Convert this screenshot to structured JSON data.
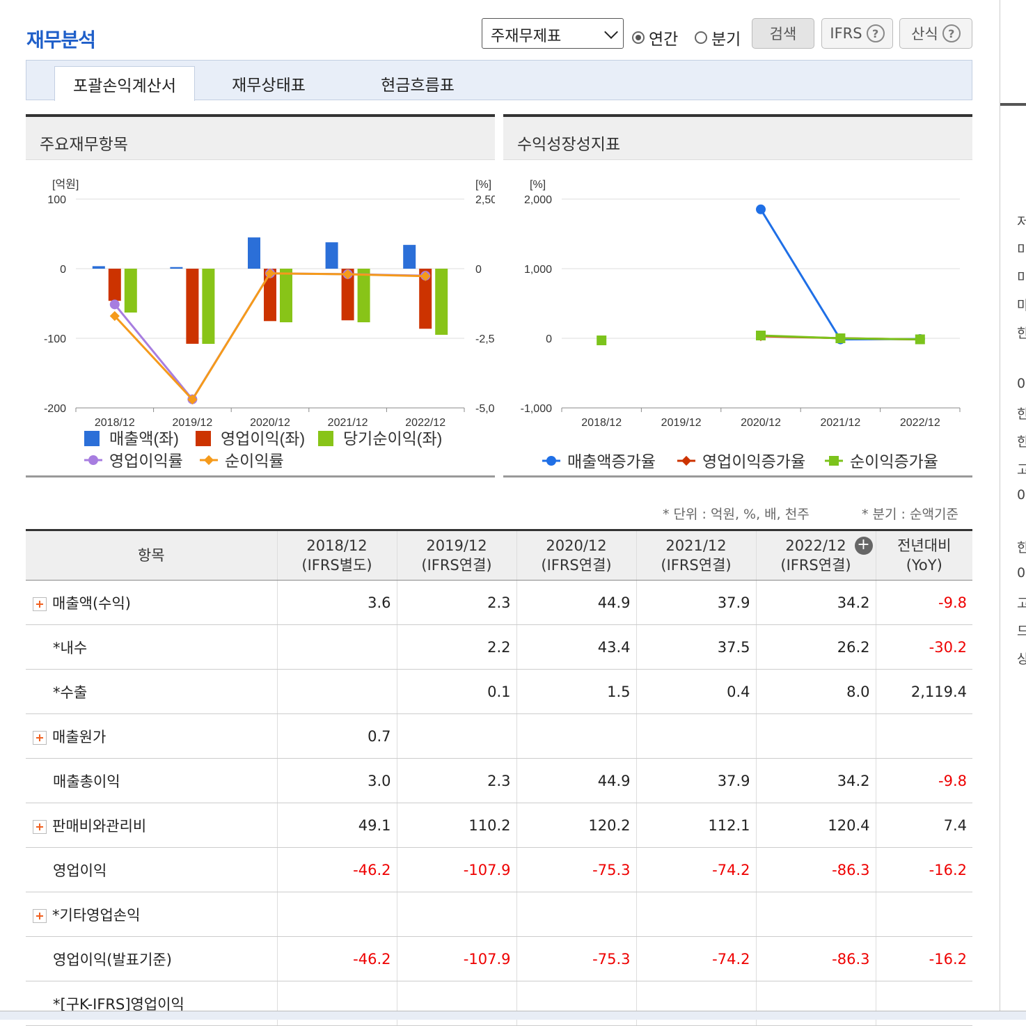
{
  "title": "재무분석",
  "controls": {
    "select_value": "주재무제표",
    "radio_annual": "연간",
    "radio_quarter": "분기",
    "search": "검색",
    "ifrs": "IFRS",
    "formula": "산식",
    "help_icon": "?"
  },
  "tabs": [
    "포괄손익계산서",
    "재무상태표",
    "현금흐름표"
  ],
  "left_panel": {
    "title": "주요재무항목"
  },
  "right_panel": {
    "title": "수익성장성지표"
  },
  "chart_data": [
    {
      "type": "bar",
      "categories": [
        "2018/12",
        "2019/12",
        "2020/12",
        "2021/12",
        "2022/12"
      ],
      "y_left": {
        "unit": "[억원]",
        "ticks": [
          "100",
          "0",
          "-100",
          "-200"
        ],
        "ylim": [
          -200,
          100
        ]
      },
      "y_right": {
        "unit": "[%]",
        "ticks": [
          "2,50",
          "0",
          "-2,5",
          "-5,0"
        ],
        "ylim": [
          -5000,
          2500
        ]
      },
      "series": [
        {
          "name": "매출액(좌)",
          "kind": "bar",
          "color": "#2b6fd8",
          "values": [
            3.6,
            2.3,
            44.9,
            37.9,
            34.2
          ]
        },
        {
          "name": "영업이익(좌)",
          "kind": "bar",
          "color": "#cc3300",
          "values": [
            -46.2,
            -107.9,
            -75.3,
            -74.2,
            -86.3
          ]
        },
        {
          "name": "당기순이익(좌)",
          "kind": "bar",
          "color": "#88c418",
          "values": [
            -63,
            -108,
            -77,
            -77,
            -95
          ]
        },
        {
          "name": "영업이익률",
          "kind": "line",
          "color": "#a77de0",
          "values": [
            -1283,
            -4691,
            -168,
            -196,
            -252
          ]
        },
        {
          "name": "순이익률",
          "kind": "line",
          "color": "#f59a1b",
          "values": [
            -1700,
            -4700,
            -170,
            -200,
            -270
          ]
        }
      ]
    },
    {
      "type": "line",
      "categories": [
        "2018/12",
        "2019/12",
        "2020/12",
        "2021/12",
        "2022/12"
      ],
      "y": {
        "unit": "[%]",
        "ticks": [
          "2,000",
          "1,000",
          "0",
          "-1,000"
        ],
        "ylim": [
          -1000,
          2000
        ]
      },
      "series": [
        {
          "name": "매출액증가율",
          "color": "#1f6fe6",
          "marker": "circle",
          "values": [
            null,
            null,
            1852,
            -16,
            -10
          ]
        },
        {
          "name": "영업이익증가율",
          "color": "#cc3300",
          "marker": "diamond",
          "values": [
            null,
            null,
            30,
            1,
            -16
          ]
        },
        {
          "name": "순이익증가율",
          "color": "#7cc31c",
          "marker": "square",
          "values": [
            -30,
            null,
            40,
            0,
            -15
          ]
        }
      ]
    }
  ],
  "unit_note": "* 단위 : 억원, %, 배, 천주",
  "quarter_note": "* 분기 : 순액기준",
  "table": {
    "header": {
      "item": "항목",
      "cols": [
        {
          "year": "2018/12",
          "basis": "(IFRS별도)"
        },
        {
          "year": "2019/12",
          "basis": "(IFRS연결)"
        },
        {
          "year": "2020/12",
          "basis": "(IFRS연결)"
        },
        {
          "year": "2021/12",
          "basis": "(IFRS연결)"
        },
        {
          "year": "2022/12",
          "basis": "(IFRS연결)"
        }
      ],
      "yoy_line1": "전년대비",
      "yoy_line2": "(YoY)",
      "expand_icon": "+"
    },
    "rows": [
      {
        "label": "매출액(수익)",
        "plus": true,
        "values": [
          "3.6",
          "2.3",
          "44.9",
          "37.9",
          "34.2",
          "-9.8"
        ]
      },
      {
        "label": "*내수",
        "plus": false,
        "indent": true,
        "values": [
          "",
          "2.2",
          "43.4",
          "37.5",
          "26.2",
          "-30.2"
        ]
      },
      {
        "label": "*수출",
        "plus": false,
        "indent": true,
        "values": [
          "",
          "0.1",
          "1.5",
          "0.4",
          "8.0",
          "2,119.4"
        ]
      },
      {
        "label": "매출원가",
        "plus": true,
        "values": [
          "0.7",
          "",
          "",
          "",
          "",
          ""
        ]
      },
      {
        "label": "매출총이익",
        "plus": false,
        "values": [
          "3.0",
          "2.3",
          "44.9",
          "37.9",
          "34.2",
          "-9.8"
        ]
      },
      {
        "label": "판매비와관리비",
        "plus": true,
        "values": [
          "49.1",
          "110.2",
          "120.2",
          "112.1",
          "120.4",
          "7.4"
        ]
      },
      {
        "label": "영업이익",
        "plus": false,
        "values": [
          "-46.2",
          "-107.9",
          "-75.3",
          "-74.2",
          "-86.3",
          "-16.2"
        ]
      },
      {
        "label": "*기타영업손익",
        "plus": true,
        "values": [
          "",
          "",
          "",
          "",
          "",
          ""
        ]
      },
      {
        "label": "영업이익(발표기준)",
        "plus": false,
        "values": [
          "-46.2",
          "-107.9",
          "-75.3",
          "-74.2",
          "-86.3",
          "-16.2"
        ]
      },
      {
        "label": "*[구K-IFRS]영업이익",
        "plus": false,
        "indent": true,
        "values": [
          "",
          "",
          "",
          "",
          "",
          ""
        ]
      }
    ]
  },
  "right_strip_chars": [
    "저",
    "미",
    "미",
    "마",
    "한",
    "0",
    "한",
    "한",
    "고",
    "0",
    "한",
    "0",
    "고",
    "드",
    "상"
  ]
}
